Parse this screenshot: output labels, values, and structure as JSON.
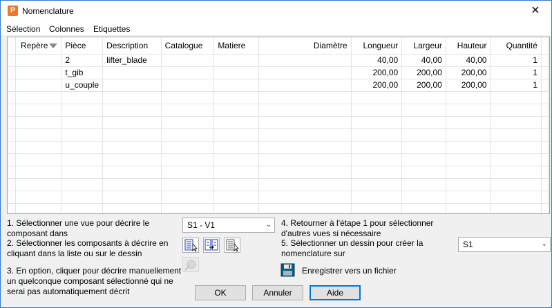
{
  "window": {
    "title": "Nomenclature",
    "app_icon_letter": "P",
    "close_glyph": "✕"
  },
  "menu": {
    "items": [
      "Sélection",
      "Colonnes",
      "Etiquettes"
    ]
  },
  "table": {
    "columns": [
      "Repère",
      "Pièce",
      "Description",
      "Catalogue",
      "Matiere",
      "Diamètre",
      "Longueur",
      "Largeur",
      "Hauteur",
      "Quantité"
    ],
    "rows": [
      [
        "",
        "2",
        "lifter_blade",
        "",
        "",
        "",
        "40,00",
        "40,00",
        "40,00",
        "1"
      ],
      [
        "",
        "t_gib",
        "",
        "",
        "",
        "",
        "200,00",
        "200,00",
        "200,00",
        "1"
      ],
      [
        "",
        "u_couple",
        "",
        "",
        "",
        "",
        "200,00",
        "200,00",
        "200,00",
        "1"
      ]
    ]
  },
  "steps": {
    "step1": [
      "1. Sélectionner une vue pour décrire le",
      "composant dans"
    ],
    "step2": [
      "2. Sélectionner les composants à décrire en",
      "cliquant dans la liste ou sur le dessin"
    ],
    "step3": [
      "3. En option, cliquer pour décrire manuellement",
      "un quelconque composant sélectionné qui ne",
      "serai pas automatiquement décrit"
    ],
    "step4": [
      "4. Retourner à l'étape 1 pour sélectionner",
      "d'autres vues si nécessaire"
    ],
    "step5": [
      "5. Sélectionner un dessin pour créer la",
      "nomenclature sur"
    ]
  },
  "view_select": {
    "value": "S1 - V1"
  },
  "drawing_select": {
    "value": "S1"
  },
  "save_label": "Enregistrer vers un fichier",
  "buttons": {
    "ok": "OK",
    "cancel": "Annuler",
    "help": "Aide"
  }
}
